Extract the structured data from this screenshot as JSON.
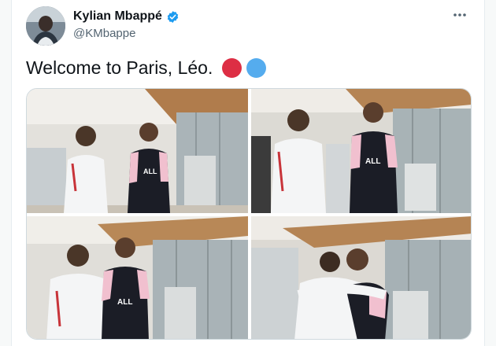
{
  "user": {
    "display_name": "Kylian Mbappé",
    "handle": "@KMbappe",
    "verified_icon": "verified-badge-icon"
  },
  "tweet": {
    "text": "Welcome to Paris, Léo.",
    "emojis": [
      {
        "name": "red-circle-emoji",
        "color": "#dd2e44"
      },
      {
        "name": "blue-circle-emoji",
        "color": "#55acee"
      }
    ]
  },
  "media": {
    "photo_count": 4
  },
  "colors": {
    "brand_blue": "#1d9bf0",
    "text_primary": "#0f1419",
    "text_secondary": "#536471"
  }
}
